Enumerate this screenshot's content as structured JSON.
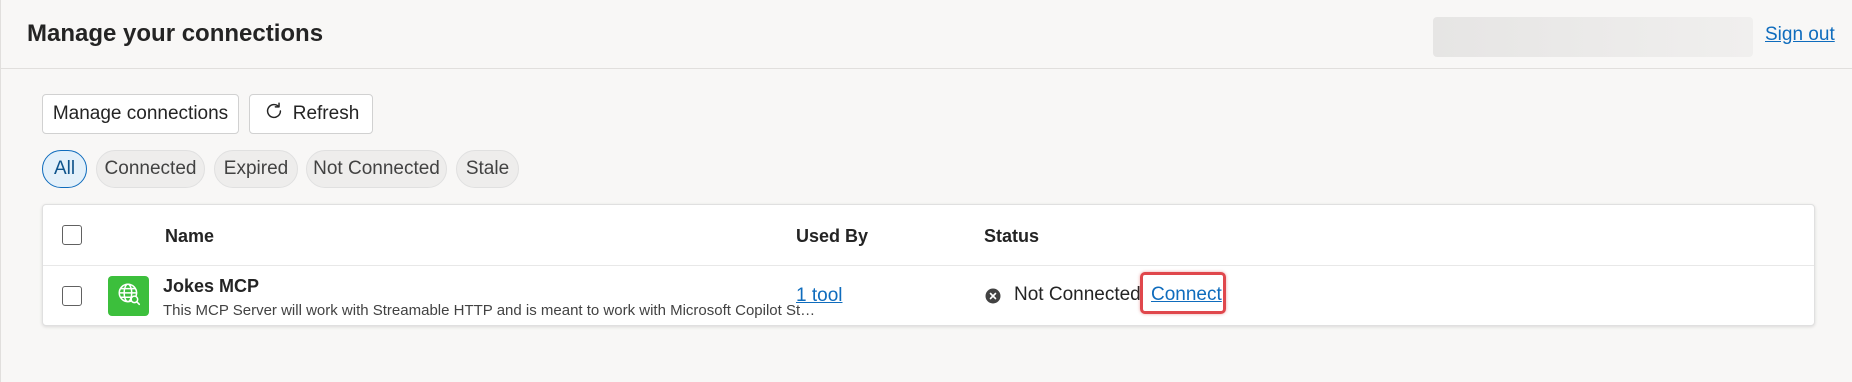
{
  "header": {
    "title": "Manage your connections",
    "sign_out": "Sign out"
  },
  "toolbar": {
    "manage_label": "Manage connections",
    "refresh_label": "Refresh"
  },
  "filters": [
    {
      "label": "All",
      "active": true
    },
    {
      "label": "Connected",
      "active": false
    },
    {
      "label": "Expired",
      "active": false
    },
    {
      "label": "Not Connected",
      "active": false
    },
    {
      "label": "Stale",
      "active": false
    }
  ],
  "table": {
    "columns": {
      "name": "Name",
      "used_by": "Used By",
      "status": "Status"
    },
    "rows": [
      {
        "name": "Jokes MCP",
        "description": "This MCP Server will work with Streamable HTTP and is meant to work with Microsoft Copilot Studio",
        "used_by": "1 tool",
        "status": "Not Connected",
        "action": "Connect",
        "icon": "globe-icon"
      }
    ]
  },
  "colors": {
    "accent": "#0f6cbd",
    "app_icon_bg": "#3cbf3c",
    "highlight": "#e0474c"
  }
}
